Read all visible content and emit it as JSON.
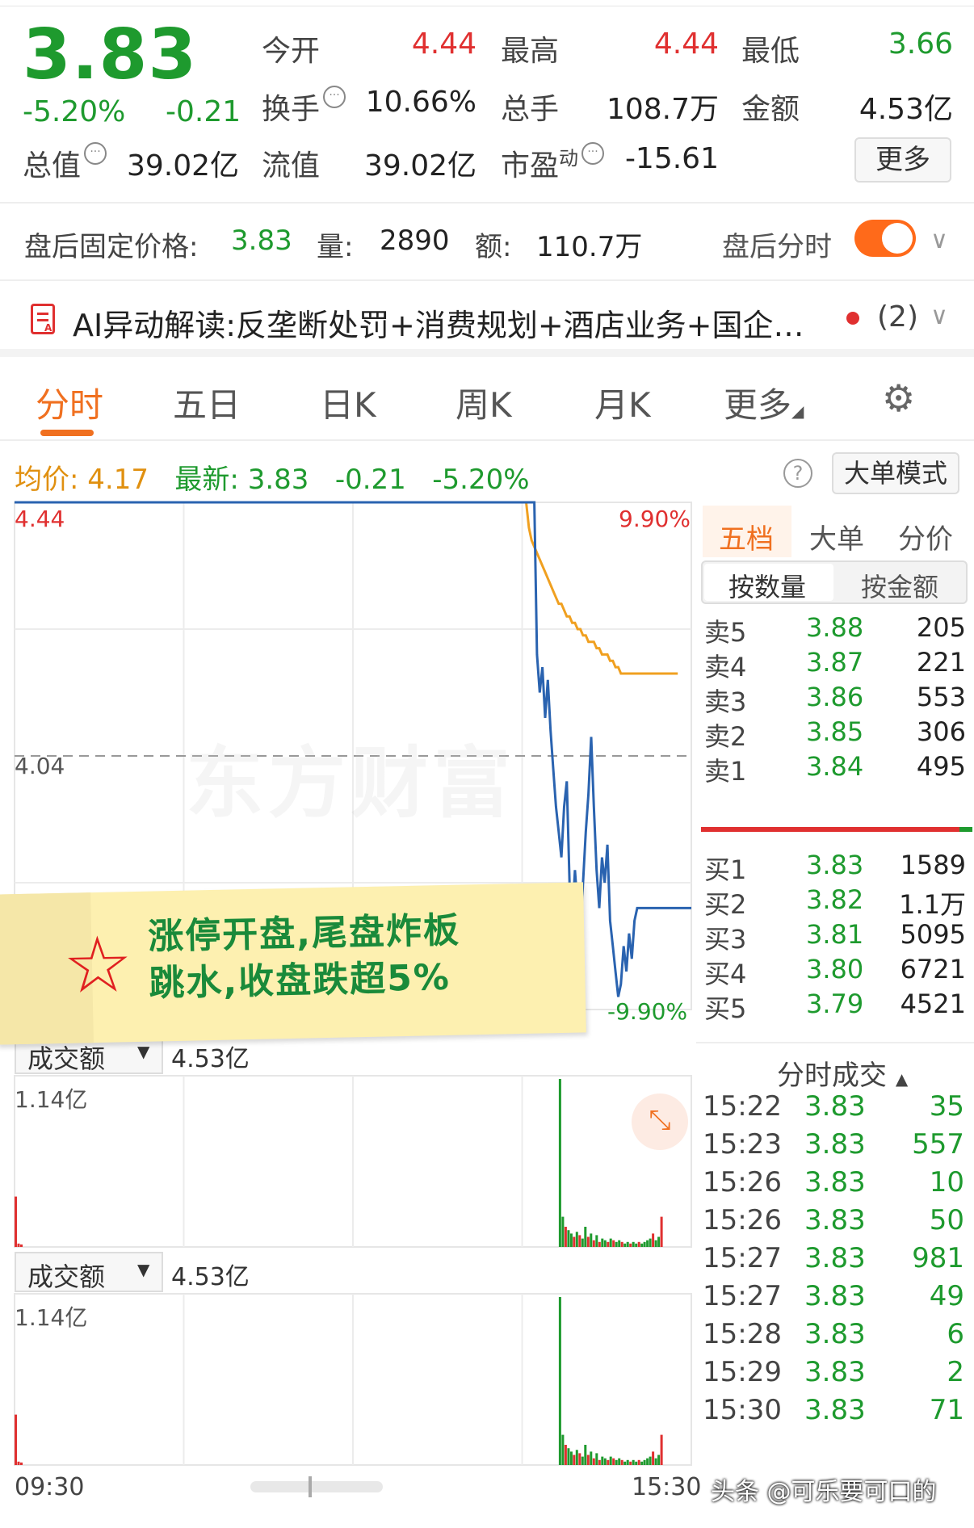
{
  "quote": {
    "price": "3.83",
    "change_pct": "-5.20%",
    "change": "-0.21",
    "fields": [
      {
        "label": "今开",
        "value": "4.44",
        "color": "red"
      },
      {
        "label": "最高",
        "value": "4.44",
        "color": "red"
      },
      {
        "label": "最低",
        "value": "3.66",
        "color": "green"
      },
      {
        "label": "换手",
        "value": "10.66%",
        "color": "dark",
        "info": true
      },
      {
        "label": "总手",
        "value": "108.7万",
        "color": "dark"
      },
      {
        "label": "金额",
        "value": "4.53亿",
        "color": "dark"
      },
      {
        "label": "总值",
        "value": "39.02亿",
        "color": "dark",
        "info": true
      },
      {
        "label": "流值",
        "value": "39.02亿",
        "color": "dark"
      },
      {
        "label": "市盈",
        "label_sup": "动",
        "value": "-15.61",
        "color": "dark",
        "info": true
      }
    ],
    "more_label": "更多"
  },
  "after_hours": {
    "label": "盘后固定价格:",
    "price": "3.83",
    "vol_label": "量:",
    "vol": "2890",
    "amt_label": "额:",
    "amt": "110.7万",
    "toggle_label": "盘后分时",
    "toggle_on": true
  },
  "ai": {
    "text": "AI异动解读:反垄断处罚+消费规划+酒店业务+国企…",
    "count": "(2)"
  },
  "tabs": [
    "分时",
    "五日",
    "日K",
    "周K",
    "月K",
    "更多"
  ],
  "info_line": {
    "avg_label": "均价:",
    "avg_value": "4.17",
    "latest_label": "最新:",
    "latest_value": "3.83",
    "change": "-0.21",
    "change_pct": "-5.20%",
    "big_order_btn": "大单模式"
  },
  "chart_data": {
    "type": "line",
    "y_top": "4.44",
    "y_mid": "4.04",
    "pct_top": "9.90%",
    "pct_bottom": "-9.90%",
    "x_start": "09:30",
    "x_end": "15:30",
    "ylim": [
      3.64,
      4.44
    ],
    "series": [
      {
        "name": "最新",
        "color": "#2a63b0",
        "values": [
          4.44,
          4.44,
          4.44,
          4.44,
          4.44,
          4.44,
          4.44,
          4.44,
          4.44,
          4.44,
          4.44,
          4.44,
          4.44,
          4.44,
          4.44,
          4.44,
          4.44,
          4.44,
          4.44,
          4.44,
          4.44,
          4.44,
          4.44,
          4.44,
          4.44,
          4.44,
          4.44,
          4.44,
          4.44,
          4.44,
          4.44,
          4.44,
          4.44,
          4.44,
          4.44,
          4.44,
          4.44,
          4.44,
          4.44,
          4.44,
          4.44,
          4.44,
          4.44,
          4.44,
          4.44,
          4.44,
          4.44,
          4.44,
          4.44,
          4.44,
          4.44,
          4.44,
          4.44,
          4.44,
          4.44,
          4.44,
          4.44,
          4.44,
          4.44,
          4.44,
          4.44,
          4.44,
          4.44,
          4.44,
          4.44,
          4.44,
          4.44,
          4.44,
          4.44,
          4.44,
          4.44,
          4.44,
          4.44,
          4.44,
          4.44,
          4.44,
          4.44,
          4.44,
          4.44,
          4.44,
          4.44,
          4.44,
          4.44,
          4.44,
          4.44,
          4.44,
          4.44,
          4.44,
          4.44,
          4.44,
          4.44,
          4.44,
          4.44,
          4.44,
          4.44,
          4.44,
          4.44,
          4.44,
          4.44,
          4.44,
          4.44,
          4.44,
          4.44,
          4.44,
          4.44,
          4.44,
          4.44,
          4.44,
          4.44,
          4.44,
          4.44,
          4.44,
          4.44,
          4.44,
          4.44,
          4.44,
          4.44,
          4.44,
          4.44,
          4.44,
          4.44,
          4.44,
          4.44,
          4.44,
          4.44,
          4.44,
          4.44,
          4.44,
          4.44,
          4.44,
          4.44,
          4.44,
          4.44,
          4.44,
          4.44,
          4.44,
          4.44,
          4.44,
          4.44,
          4.44,
          4.44,
          4.44,
          4.44,
          4.44,
          4.44,
          4.44,
          4.44,
          4.44,
          4.44,
          4.44,
          4.44,
          4.44,
          4.44,
          4.44,
          4.44,
          4.44,
          4.44,
          4.44,
          4.44,
          4.44,
          4.44,
          4.44,
          4.44,
          4.44,
          4.44,
          4.44,
          4.44,
          4.44,
          4.44,
          4.44,
          4.44,
          4.44,
          4.44,
          4.44,
          4.44,
          4.44,
          4.44,
          4.44,
          4.44,
          4.44,
          4.44,
          4.44,
          4.44,
          4.44,
          4.44,
          4.44,
          4.44,
          4.44,
          4.44,
          4.44,
          4.44,
          4.44,
          4.44,
          4.2,
          4.14,
          4.18,
          4.1,
          4.16,
          4.08,
          4.02,
          3.96,
          3.92,
          3.88,
          3.96,
          4.0,
          3.84,
          3.78,
          3.86,
          3.8,
          3.76,
          3.84,
          3.92,
          3.98,
          4.07,
          3.96,
          3.86,
          3.8,
          3.88,
          3.84,
          3.9,
          3.78,
          3.74,
          3.7,
          3.66,
          3.68,
          3.74,
          3.7,
          3.76,
          3.72,
          3.78,
          3.8,
          3.8,
          3.8,
          3.8,
          3.8,
          3.8,
          3.8,
          3.8,
          3.8,
          3.8,
          3.8,
          3.8,
          3.8,
          3.8,
          3.8,
          3.8,
          3.8,
          3.8,
          3.8,
          3.8,
          3.8
        ]
      },
      {
        "name": "均价",
        "color": "#f0a020",
        "values": [
          4.44,
          4.44,
          4.44,
          4.44,
          4.44,
          4.44,
          4.44,
          4.44,
          4.44,
          4.44,
          4.44,
          4.44,
          4.44,
          4.44,
          4.44,
          4.44,
          4.44,
          4.44,
          4.44,
          4.44,
          4.44,
          4.44,
          4.44,
          4.44,
          4.44,
          4.44,
          4.44,
          4.44,
          4.44,
          4.44,
          4.44,
          4.44,
          4.44,
          4.44,
          4.44,
          4.44,
          4.44,
          4.44,
          4.44,
          4.44,
          4.44,
          4.44,
          4.44,
          4.44,
          4.44,
          4.44,
          4.44,
          4.44,
          4.44,
          4.44,
          4.44,
          4.44,
          4.44,
          4.44,
          4.44,
          4.44,
          4.44,
          4.44,
          4.44,
          4.44,
          4.44,
          4.44,
          4.44,
          4.44,
          4.44,
          4.44,
          4.44,
          4.44,
          4.44,
          4.44,
          4.44,
          4.44,
          4.44,
          4.44,
          4.44,
          4.44,
          4.44,
          4.44,
          4.44,
          4.44,
          4.44,
          4.44,
          4.44,
          4.44,
          4.44,
          4.44,
          4.44,
          4.44,
          4.44,
          4.44,
          4.44,
          4.44,
          4.44,
          4.44,
          4.44,
          4.44,
          4.44,
          4.44,
          4.44,
          4.44,
          4.44,
          4.44,
          4.44,
          4.44,
          4.44,
          4.44,
          4.44,
          4.44,
          4.44,
          4.44,
          4.44,
          4.44,
          4.44,
          4.44,
          4.44,
          4.44,
          4.44,
          4.44,
          4.44,
          4.44,
          4.44,
          4.44,
          4.44,
          4.44,
          4.44,
          4.44,
          4.44,
          4.44,
          4.44,
          4.44,
          4.44,
          4.44,
          4.44,
          4.44,
          4.44,
          4.44,
          4.44,
          4.44,
          4.44,
          4.44,
          4.44,
          4.44,
          4.44,
          4.44,
          4.44,
          4.44,
          4.44,
          4.44,
          4.44,
          4.44,
          4.44,
          4.44,
          4.44,
          4.44,
          4.44,
          4.44,
          4.44,
          4.44,
          4.44,
          4.44,
          4.44,
          4.44,
          4.44,
          4.44,
          4.44,
          4.44,
          4.44,
          4.44,
          4.44,
          4.44,
          4.44,
          4.44,
          4.44,
          4.44,
          4.44,
          4.44,
          4.44,
          4.44,
          4.44,
          4.44,
          4.44,
          4.44,
          4.44,
          4.44,
          4.44,
          4.44,
          4.44,
          4.44,
          4.44,
          4.44,
          4.4,
          4.38,
          4.37,
          4.36,
          4.35,
          4.34,
          4.33,
          4.32,
          4.31,
          4.3,
          4.29,
          4.28,
          4.28,
          4.27,
          4.26,
          4.26,
          4.25,
          4.25,
          4.24,
          4.24,
          4.23,
          4.23,
          4.22,
          4.22,
          4.22,
          4.21,
          4.21,
          4.2,
          4.2,
          4.2,
          4.19,
          4.19,
          4.18,
          4.18,
          4.17,
          4.17,
          4.17,
          4.17,
          4.17,
          4.17,
          4.17,
          4.17,
          4.17,
          4.17,
          4.17,
          4.17,
          4.17,
          4.17,
          4.17,
          4.17,
          4.17,
          4.17,
          4.17,
          4.17,
          4.17,
          4.17
        ]
      }
    ],
    "volume": {
      "label": "成交额",
      "total": "4.53亿",
      "max_label": "1.14亿",
      "bars": [
        {
          "i": 0,
          "v": 0.3,
          "c": "red"
        },
        {
          "i": 1,
          "v": 0.02,
          "c": "red"
        },
        {
          "i": 2,
          "v": 0.015,
          "c": "red"
        },
        {
          "i": 193,
          "v": 1.0,
          "c": "green"
        },
        {
          "i": 194,
          "v": 0.18,
          "c": "green"
        },
        {
          "i": 195,
          "v": 0.12,
          "c": "red"
        },
        {
          "i": 196,
          "v": 0.1,
          "c": "green"
        },
        {
          "i": 197,
          "v": 0.08,
          "c": "green"
        },
        {
          "i": 198,
          "v": 0.06,
          "c": "red"
        },
        {
          "i": 199,
          "v": 0.09,
          "c": "green"
        },
        {
          "i": 200,
          "v": 0.07,
          "c": "red"
        },
        {
          "i": 201,
          "v": 0.05,
          "c": "green"
        },
        {
          "i": 202,
          "v": 0.12,
          "c": "green"
        },
        {
          "i": 203,
          "v": 0.06,
          "c": "red"
        },
        {
          "i": 204,
          "v": 0.08,
          "c": "green"
        },
        {
          "i": 205,
          "v": 0.04,
          "c": "red"
        },
        {
          "i": 206,
          "v": 0.07,
          "c": "green"
        },
        {
          "i": 207,
          "v": 0.03,
          "c": "red"
        },
        {
          "i": 208,
          "v": 0.05,
          "c": "green"
        },
        {
          "i": 209,
          "v": 0.04,
          "c": "green"
        },
        {
          "i": 210,
          "v": 0.03,
          "c": "red"
        },
        {
          "i": 211,
          "v": 0.05,
          "c": "green"
        },
        {
          "i": 212,
          "v": 0.04,
          "c": "red"
        },
        {
          "i": 213,
          "v": 0.03,
          "c": "green"
        },
        {
          "i": 214,
          "v": 0.04,
          "c": "green"
        },
        {
          "i": 215,
          "v": 0.03,
          "c": "red"
        },
        {
          "i": 216,
          "v": 0.02,
          "c": "green"
        },
        {
          "i": 217,
          "v": 0.03,
          "c": "green"
        },
        {
          "i": 218,
          "v": 0.02,
          "c": "red"
        },
        {
          "i": 219,
          "v": 0.03,
          "c": "green"
        },
        {
          "i": 220,
          "v": 0.02,
          "c": "green"
        },
        {
          "i": 221,
          "v": 0.03,
          "c": "red"
        },
        {
          "i": 222,
          "v": 0.02,
          "c": "green"
        },
        {
          "i": 223,
          "v": 0.03,
          "c": "green"
        },
        {
          "i": 224,
          "v": 0.04,
          "c": "green"
        },
        {
          "i": 225,
          "v": 0.05,
          "c": "green"
        },
        {
          "i": 226,
          "v": 0.08,
          "c": "red"
        },
        {
          "i": 227,
          "v": 0.04,
          "c": "green"
        },
        {
          "i": 228,
          "v": 0.06,
          "c": "green"
        },
        {
          "i": 229,
          "v": 0.18,
          "c": "red"
        }
      ],
      "total_points": 241
    }
  },
  "order_book": {
    "tabs": [
      "五档",
      "大单",
      "分价"
    ],
    "seg": [
      "按数量",
      "按金额"
    ],
    "asks": [
      {
        "k": "卖5",
        "p": "3.88",
        "v": "205"
      },
      {
        "k": "卖4",
        "p": "3.87",
        "v": "221"
      },
      {
        "k": "卖3",
        "p": "3.86",
        "v": "553"
      },
      {
        "k": "卖2",
        "p": "3.85",
        "v": "306"
      },
      {
        "k": "卖1",
        "p": "3.84",
        "v": "495"
      }
    ],
    "bids": [
      {
        "k": "买1",
        "p": "3.83",
        "v": "1589"
      },
      {
        "k": "买2",
        "p": "3.82",
        "v": "1.1万"
      },
      {
        "k": "买3",
        "p": "3.81",
        "v": "5095"
      },
      {
        "k": "买4",
        "p": "3.80",
        "v": "6721"
      },
      {
        "k": "买5",
        "p": "3.79",
        "v": "4521"
      }
    ]
  },
  "ticks": {
    "title": "分时成交",
    "rows": [
      {
        "t": "15:22",
        "p": "3.83",
        "v": "35"
      },
      {
        "t": "15:23",
        "p": "3.83",
        "v": "557"
      },
      {
        "t": "15:26",
        "p": "3.83",
        "v": "10"
      },
      {
        "t": "15:26",
        "p": "3.83",
        "v": "50"
      },
      {
        "t": "15:27",
        "p": "3.83",
        "v": "981"
      },
      {
        "t": "15:27",
        "p": "3.83",
        "v": "49"
      },
      {
        "t": "15:28",
        "p": "3.83",
        "v": "6"
      },
      {
        "t": "15:29",
        "p": "3.83",
        "v": "2"
      },
      {
        "t": "15:30",
        "p": "3.83",
        "v": "71"
      }
    ]
  },
  "note": {
    "line1": "涨停开盘,尾盘炸板",
    "line2": "跳水,收盘跌超5%"
  },
  "watermark": "东方财富",
  "credit": "头条 @可乐要可口的"
}
